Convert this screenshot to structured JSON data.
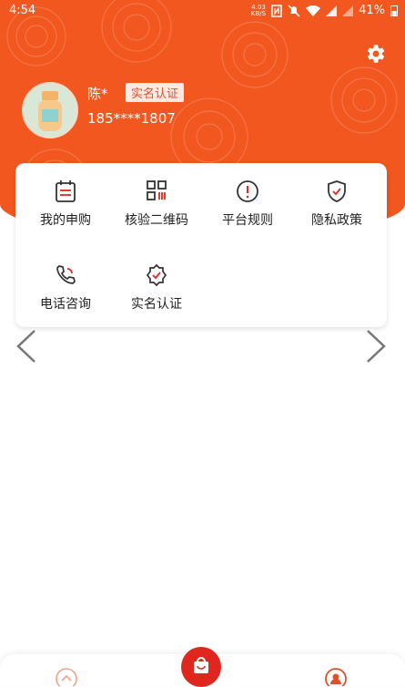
{
  "status": {
    "time": "4:54",
    "net_speed": "4.03",
    "net_unit": "KB/S",
    "battery": "41%"
  },
  "profile": {
    "name": "陈*",
    "verify_badge": "实名认证",
    "phone": "185****1807"
  },
  "menu": {
    "items": [
      {
        "label": "我的申购",
        "icon": "calendar-icon"
      },
      {
        "label": "核验二维码",
        "icon": "qrcode-icon"
      },
      {
        "label": "平台规则",
        "icon": "alert-circle-icon"
      },
      {
        "label": "隐私政策",
        "icon": "shield-check-icon"
      },
      {
        "label": "电话咨询",
        "icon": "phone-icon"
      },
      {
        "label": "实名认证",
        "icon": "verified-badge-icon"
      }
    ]
  },
  "colors": {
    "brand": "#f1571f",
    "accent": "#e0271f"
  }
}
